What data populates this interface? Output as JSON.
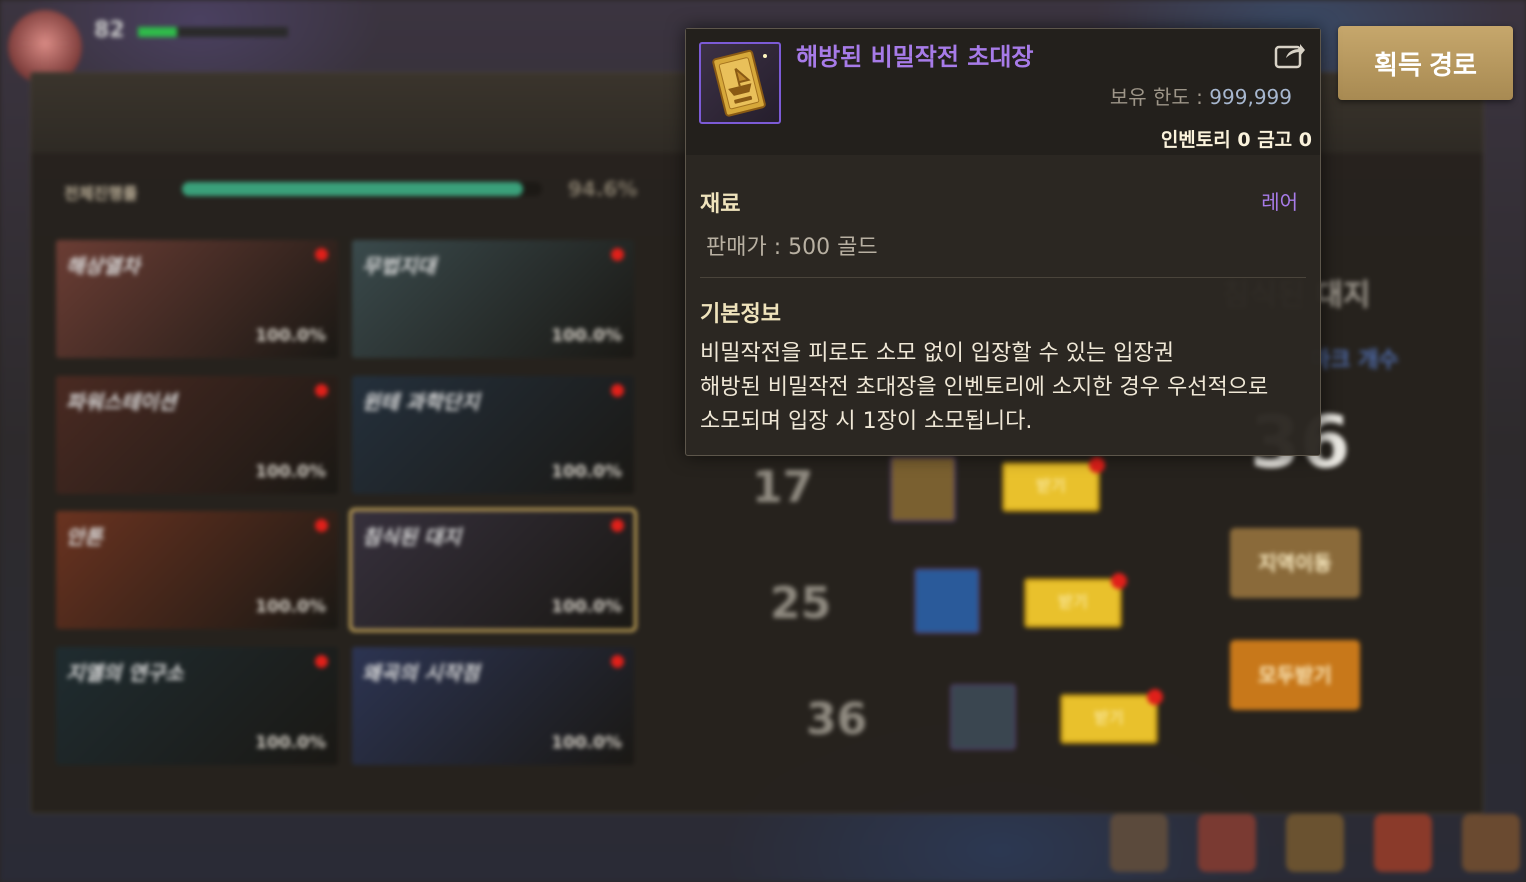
{
  "background": {
    "player_level": "82",
    "overall_progress_label": "전체진행률",
    "overall_progress_percent": 94.6,
    "overall_progress_text": "94.6%",
    "regions": [
      {
        "name": "해상열차",
        "progress": "100.0%",
        "color": "#6b3d34"
      },
      {
        "name": "무법지대",
        "progress": "100.0%",
        "color": "#3a4a4c"
      },
      {
        "name": "파워스테이션",
        "progress": "100.0%",
        "color": "#4a2a22"
      },
      {
        "name": "윈테 과학단지",
        "progress": "100.0%",
        "color": "#24303c"
      },
      {
        "name": "안톤",
        "progress": "100.0%",
        "color": "#6a3320"
      },
      {
        "name": "침식된 대지",
        "progress": "100.0%",
        "color": "#36303c",
        "selected": true
      },
      {
        "name": "지옐의 연구소",
        "progress": "100.0%",
        "color": "#1f2c30"
      },
      {
        "name": "왜곡의 시작점",
        "progress": "100.0%",
        "color": "#2c3452"
      }
    ],
    "reward_rows": [
      {
        "count": "17",
        "claim": "받기"
      },
      {
        "count": "25",
        "claim": "받기"
      },
      {
        "count": "36",
        "claim": "받기"
      }
    ],
    "big_count": "36",
    "region_title": "침식된 대지",
    "sub_label": "마크 개수",
    "move_button": "지역이동",
    "claim_all_button": "모두받기",
    "bottom_icons": [
      {
        "name": "스케줄러",
        "color": "#5b4a3c"
      },
      {
        "name": "상점",
        "color": "#7a3a32"
      },
      {
        "name": "제작",
        "color": "#6a5230"
      },
      {
        "name": "모험",
        "color": "#8a3a2a"
      },
      {
        "name": "인벤토리",
        "color": "#6a4a30"
      }
    ]
  },
  "acquire_button": "획득 경로",
  "tooltip": {
    "item_name": "해방된 비밀작전 초대장",
    "holding_limit_label": "보유 한도 :",
    "holding_limit_value": "999,999",
    "inventory_storage": "인벤토리 0 금고 0",
    "category": "재료",
    "rarity": "레어",
    "sell_price": "판매가 : 500 골드",
    "basic_info_title": "기본정보",
    "description": [
      "비밀작전을 피로도 소모 없이 입장할 수 있는 입장권",
      "해방된 비밀작전 초대장을 인벤토리에 소지한 경우 우선적으로",
      "소모되며 입장 시 1장이 소모됩니다."
    ]
  },
  "colors": {
    "item_name": "#a77be8",
    "rarity": "#a77be8",
    "section_label": "#efe3bc",
    "acquire_button": "#b8996a"
  },
  "icons": {
    "item": "golden-ticket-icon",
    "share": "share-icon"
  }
}
